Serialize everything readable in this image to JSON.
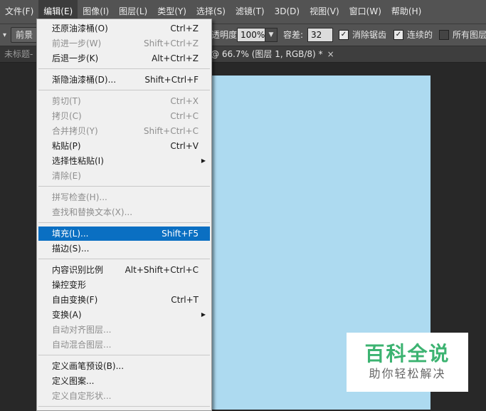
{
  "menubar": {
    "items": [
      "文件(F)",
      "编辑(E)",
      "图像(I)",
      "图层(L)",
      "类型(Y)",
      "选择(S)",
      "滤镜(T)",
      "3D(D)",
      "视图(V)",
      "窗口(W)",
      "帮助(H)"
    ]
  },
  "options": {
    "tool_arrow": "▾",
    "mode_label": "前景",
    "opacity_label": "透明度:",
    "opacity_value": "100%",
    "tolerance_label": "容差:",
    "tolerance_value": "32",
    "antialias_label": "消除锯齿",
    "contiguous_label": "连续的",
    "all_layers_label": "所有图层"
  },
  "tabs": {
    "tab1": "未标题-",
    "tab2": "@ 66.7% (图层 1, RGB/8) *",
    "close": "×"
  },
  "edit_menu": {
    "items": [
      {
        "label": "还原油漆桶(O)",
        "shortcut": "Ctrl+Z"
      },
      {
        "label": "前进一步(W)",
        "shortcut": "Shift+Ctrl+Z"
      },
      {
        "label": "后退一步(K)",
        "shortcut": "Alt+Ctrl+Z"
      },
      {
        "label": "渐隐油漆桶(D)...",
        "shortcut": "Shift+Ctrl+F"
      },
      {
        "label": "剪切(T)",
        "shortcut": "Ctrl+X"
      },
      {
        "label": "拷贝(C)",
        "shortcut": "Ctrl+C"
      },
      {
        "label": "合并拷贝(Y)",
        "shortcut": "Shift+Ctrl+C"
      },
      {
        "label": "粘贴(P)",
        "shortcut": "Ctrl+V"
      },
      {
        "label": "选择性粘贴(I)",
        "shortcut": ""
      },
      {
        "label": "清除(E)",
        "shortcut": ""
      },
      {
        "label": "拼写检查(H)...",
        "shortcut": ""
      },
      {
        "label": "查找和替换文本(X)...",
        "shortcut": ""
      },
      {
        "label": "填充(L)...",
        "shortcut": "Shift+F5"
      },
      {
        "label": "描边(S)...",
        "shortcut": ""
      },
      {
        "label": "内容识别比例",
        "shortcut": "Alt+Shift+Ctrl+C"
      },
      {
        "label": "操控变形",
        "shortcut": ""
      },
      {
        "label": "自由变换(F)",
        "shortcut": "Ctrl+T"
      },
      {
        "label": "变换(A)",
        "shortcut": ""
      },
      {
        "label": "自动对齐图层...",
        "shortcut": ""
      },
      {
        "label": "自动混合图层...",
        "shortcut": ""
      },
      {
        "label": "定义画笔预设(B)...",
        "shortcut": ""
      },
      {
        "label": "定义图案...",
        "shortcut": ""
      },
      {
        "label": "定义自定形状...",
        "shortcut": ""
      }
    ],
    "submenu_arrow": "▶"
  },
  "watermark": {
    "title": "百科全说",
    "subtitle": "助你轻松解决"
  },
  "colors": {
    "highlight": "#0a6fc2",
    "canvas": "#addaf0",
    "watermark_green": "#3cb371"
  }
}
